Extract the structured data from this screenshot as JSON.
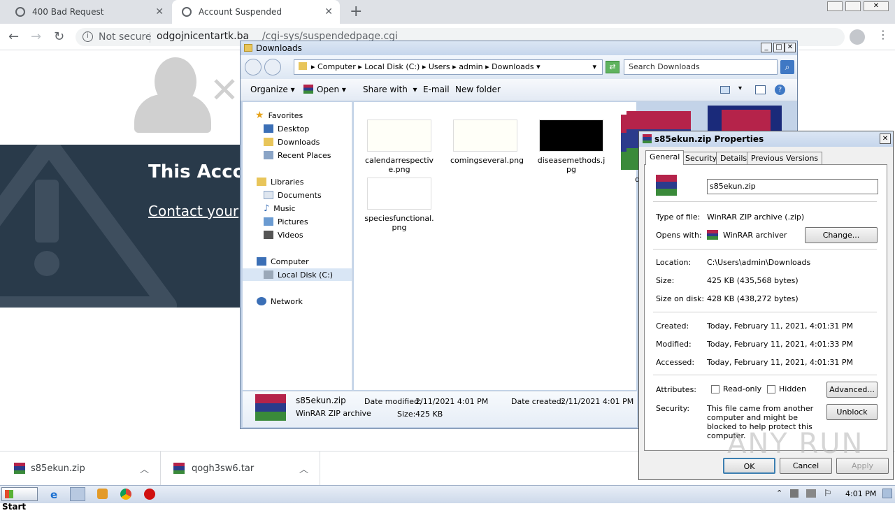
{
  "browser": {
    "tabs": [
      {
        "title": "400 Bad Request"
      },
      {
        "title": "Account Suspended"
      }
    ],
    "security_label": "Not secure",
    "url_host": "odgojnicentartk.ba",
    "url_path": "/cgi-sys/suspendedpage.cgi"
  },
  "page": {
    "heading": "This Acco",
    "link": "Contact your"
  },
  "downloads_bar": {
    "items": [
      {
        "name": "s85ekun.zip"
      },
      {
        "name": "qogh3sw6.tar"
      }
    ]
  },
  "explorer": {
    "title": "Downloads",
    "breadcrumb": [
      "Computer",
      "Local Disk (C:)",
      "Users",
      "admin",
      "Downloads"
    ],
    "search_placeholder": "Search Downloads",
    "toolbar": {
      "organize": "Organize",
      "open": "Open",
      "share": "Share with",
      "email": "E-mail",
      "new_folder": "New folder"
    },
    "nav": {
      "favorites": "Favorites",
      "desktop": "Desktop",
      "downloads": "Downloads",
      "recent": "Recent Places",
      "libraries": "Libraries",
      "documents": "Documents",
      "music": "Music",
      "pictures": "Pictures",
      "videos": "Videos",
      "computer": "Computer",
      "local_disk": "Local Disk (C:)",
      "network": "Network"
    },
    "files": [
      {
        "name": "calendarrespective.png",
        "thumb": "#fffff8"
      },
      {
        "name": "comingseveral.png",
        "thumb": "#fffff8"
      },
      {
        "name": "diseasemethods.jpg",
        "thumb": "#000000"
      },
      {
        "name": "speciesfunctional.png",
        "thumb": "#ffffff"
      },
      {
        "name": "q"
      }
    ],
    "details": {
      "name": "s85ekun.zip",
      "type": "WinRAR ZIP archive",
      "date_modified_label": "Date modified:",
      "date_modified": "2/11/2021 4:01 PM",
      "date_created_label": "Date created:",
      "date_created": "2/11/2021 4:01 PM",
      "size_label": "Size:",
      "size": "425 KB"
    }
  },
  "properties": {
    "title": "s85ekun.zip Properties",
    "tabs": [
      "General",
      "Security",
      "Details",
      "Previous Versions"
    ],
    "filename": "s85ekun.zip",
    "type_label": "Type of file:",
    "type_value": "WinRAR ZIP archive (.zip)",
    "opens_label": "Opens with:",
    "opens_value": "WinRAR archiver",
    "change": "Change...",
    "location_label": "Location:",
    "location_value": "C:\\Users\\admin\\Downloads",
    "size_label": "Size:",
    "size_value": "425 KB (435,568 bytes)",
    "disk_label": "Size on disk:",
    "disk_value": "428 KB (438,272 bytes)",
    "created_label": "Created:",
    "created_value": "Today, February 11, 2021, 4:01:31 PM",
    "modified_label": "Modified:",
    "modified_value": "Today, February 11, 2021, 4:01:33 PM",
    "accessed_label": "Accessed:",
    "accessed_value": "Today, February 11, 2021, 4:01:31 PM",
    "attributes_label": "Attributes:",
    "readonly": "Read-only",
    "hidden": "Hidden",
    "advanced": "Advanced...",
    "security_label": "Security:",
    "security_text": "This file came from another computer and might be blocked to help protect this computer.",
    "unblock": "Unblock",
    "ok": "OK",
    "cancel": "Cancel",
    "apply": "Apply"
  },
  "taskbar": {
    "start": "Start",
    "time": "4:01 PM"
  },
  "watermark": "ANY RUN"
}
